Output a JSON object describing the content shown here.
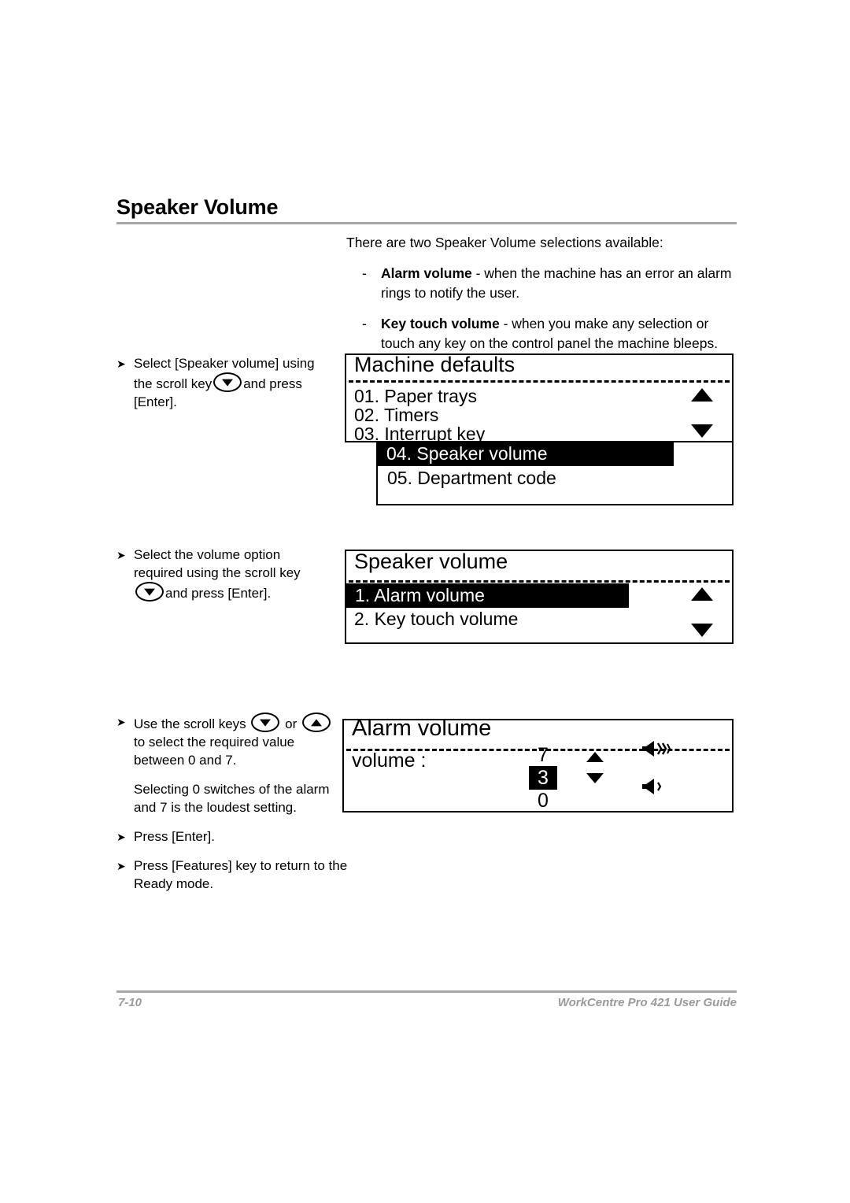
{
  "page": {
    "title": "Speaker Volume",
    "footer_page_number": "7-10",
    "footer_guide": "WorkCentre Pro 421 User Guide"
  },
  "intro": {
    "lead": "There are two Speaker Volume selections available:",
    "bullets": [
      {
        "marker": "-",
        "bold": "Alarm volume",
        "rest": " - when the machine has an error an alarm rings to notify the user."
      },
      {
        "marker": "-",
        "bold": "Key touch volume",
        "rest": " - when you make any selection or touch any key on the control panel the machine bleeps."
      }
    ]
  },
  "steps": {
    "step1": {
      "marker": "➤",
      "part1": "Select [Speaker volume] using the scroll key",
      "icon": "scroll-down-key-icon",
      "part2": "and press [Enter]."
    },
    "step2": {
      "marker": "➤",
      "part1": "Select the volume option required using the scroll key",
      "icon": "scroll-down-key-icon",
      "part2": "and press [Enter]."
    },
    "step3": {
      "marker": "➤",
      "part1": "Use the scroll keys",
      "icon_down": "scroll-down-key-icon",
      "part2": "or",
      "icon_up": "scroll-up-key-icon",
      "part3": "to select the required value between 0 and 7."
    },
    "note3": "Selecting 0 switches of the alarm and 7 is the loudest setting.",
    "step4": {
      "marker": "➤",
      "text": "Press [Enter]."
    },
    "step5": {
      "marker": "➤",
      "text": "Press [Features] key to return to the Ready mode."
    }
  },
  "lcd_panels": [
    {
      "name": "machine-defaults",
      "title": "Machine defaults",
      "upper_items": [
        "01. Paper trays",
        "02. Timers",
        "03. Interrupt key"
      ],
      "lower_items": [
        "04. Speaker volume",
        "05. Department code"
      ],
      "selected": "04. Speaker volume",
      "scroll_up_icon": "scroll-up-arrow-icon",
      "scroll_down_icon": "scroll-down-arrow-icon"
    },
    {
      "name": "speaker-volume",
      "title": "Speaker volume",
      "items": [
        "1. Alarm volume",
        "2. Key touch volume"
      ],
      "selected": "1. Alarm volume",
      "scroll_up_icon": "scroll-up-arrow-icon",
      "scroll_down_icon": "scroll-down-arrow-icon"
    },
    {
      "name": "alarm-volume",
      "title": "Alarm volume",
      "value_label": "volume :",
      "value_max": "7",
      "value_current": "3",
      "value_min": "0",
      "scroll_up_icon": "scroll-up-arrow-icon",
      "scroll_down_icon": "scroll-down-arrow-icon",
      "speaker_loud_icon": "speaker-loud-icon",
      "speaker_quiet_icon": "speaker-quiet-icon"
    }
  ]
}
